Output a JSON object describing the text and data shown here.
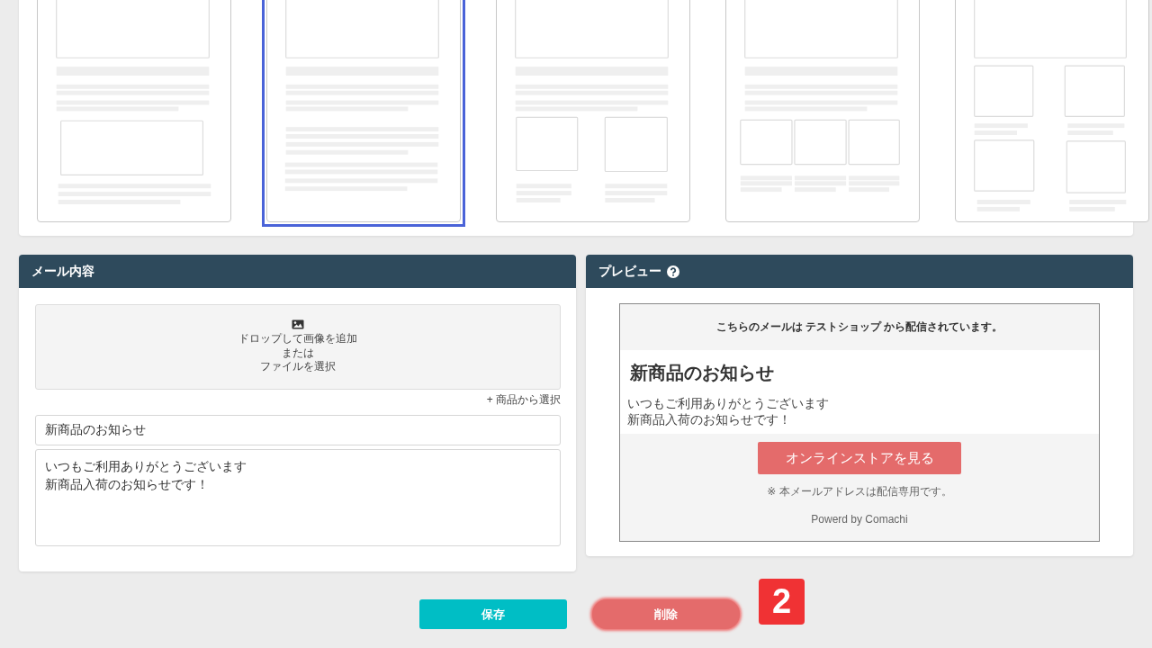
{
  "templates": [
    {
      "kind": "image-box",
      "selected": false
    },
    {
      "kind": "text-only",
      "selected": true
    },
    {
      "kind": "two-column",
      "selected": false
    },
    {
      "kind": "three-column",
      "selected": false
    },
    {
      "kind": "grid",
      "selected": false
    }
  ],
  "editor": {
    "title": "メール内容",
    "dropzone_lines": [
      "ドロップして画像を追加",
      "または",
      "ファイルを選択"
    ],
    "product_link": "+ 商品から選択",
    "subject": "新商品のお知らせ",
    "body_lines": [
      "いつもご利用ありがとうございます",
      "新商品入荷のお知らせです！"
    ]
  },
  "preview": {
    "title": "プレビュー",
    "sender_notice": "こちらのメールは テストショップ から配信されています。",
    "heading": "新商品のお知らせ",
    "body_lines": [
      "いつもご利用ありがとうございます",
      "新商品入荷のお知らせです！"
    ],
    "cta": "オンラインストアを見る",
    "note": "※ 本メールアドレスは配信専用です。",
    "footer": "Powerd by Comachi"
  },
  "actions": [
    {
      "kind": "save",
      "label": "保存",
      "highlighted": false
    },
    {
      "kind": "delete",
      "label": "削除",
      "highlighted": true
    }
  ],
  "step_badge": "2"
}
